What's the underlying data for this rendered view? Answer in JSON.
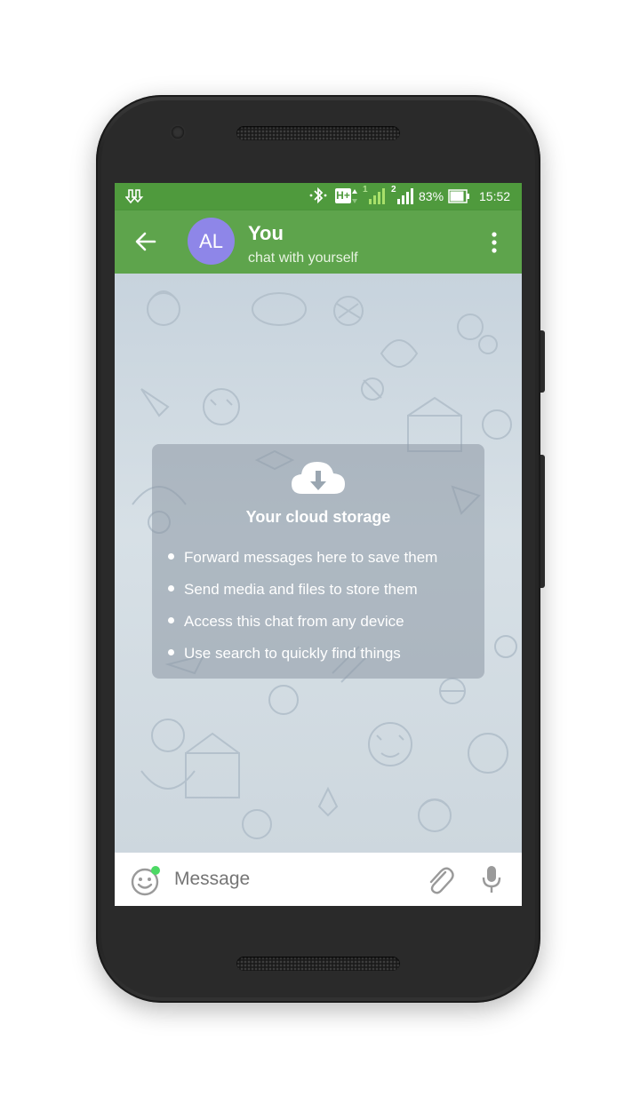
{
  "status_bar": {
    "time": "15:52",
    "battery": "83%",
    "network_type": "H+",
    "sim1_label": "1",
    "sim2_label": "2"
  },
  "header": {
    "avatar_initials": "AL",
    "title": "You",
    "subtitle": "chat with yourself"
  },
  "empty_state": {
    "title": "Your cloud storage",
    "bullets": [
      "Forward messages here to save them",
      "Send media and files to store them",
      "Access this chat from any device",
      "Use search to quickly find things"
    ]
  },
  "composer": {
    "placeholder": "Message"
  },
  "icons": {
    "back": "arrow-left-icon",
    "menu": "more-vert-icon",
    "cloud": "cloud-download-icon",
    "emoji": "emoji-icon",
    "attach": "paperclip-icon",
    "mic": "microphone-icon"
  },
  "colors": {
    "header": "#5ea44c",
    "status_bar": "#4f9a3d",
    "avatar": "#8e86e8",
    "chat_background": "#ccd6df",
    "card": "#8c98a4",
    "emoji_badge": "#4cd964"
  }
}
